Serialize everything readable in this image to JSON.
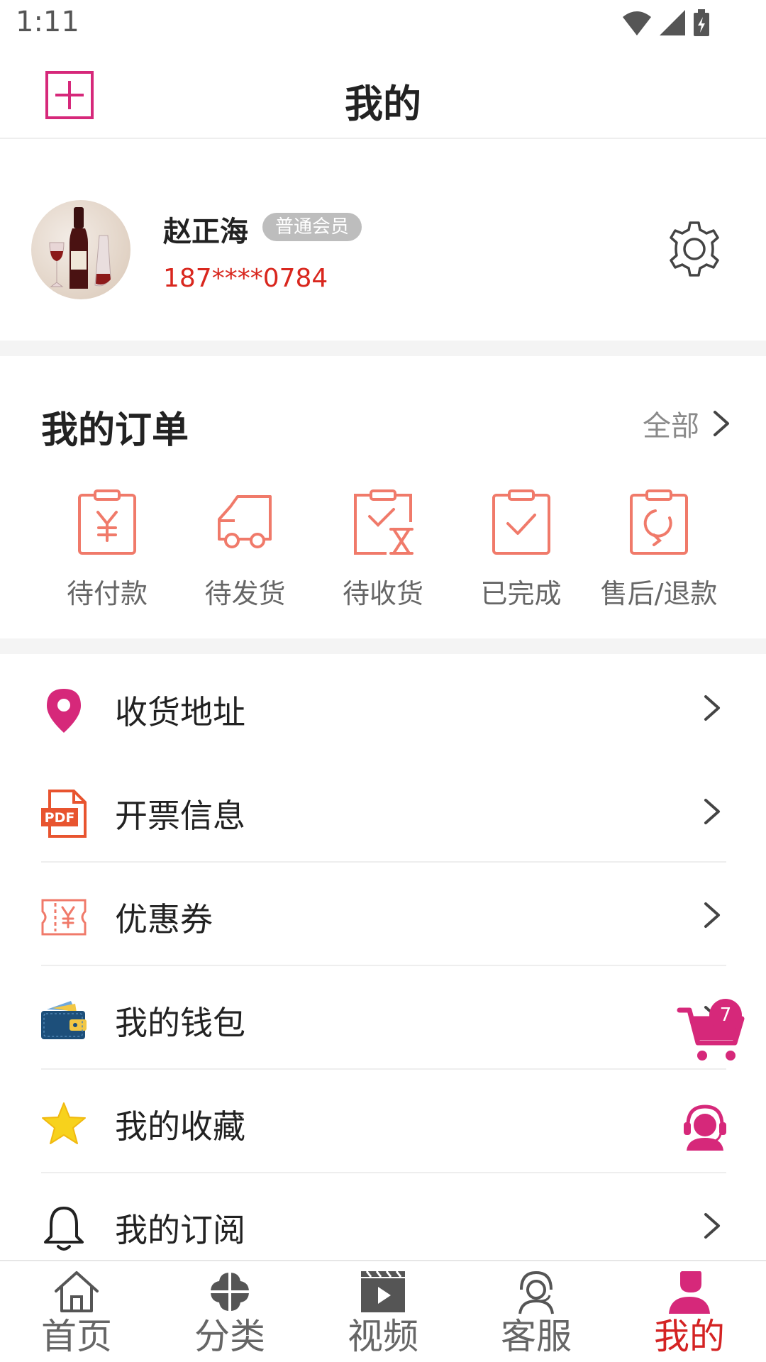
{
  "status_bar": {
    "time": "1:11"
  },
  "header": {
    "title": "我的"
  },
  "profile": {
    "name": "赵正海",
    "member_level": "普通会员",
    "phone": "187****0784"
  },
  "orders": {
    "title": "我的订单",
    "all_label": "全部",
    "items": [
      {
        "label": "待付款",
        "icon": "pending-payment-icon"
      },
      {
        "label": "待发货",
        "icon": "pending-shipment-icon"
      },
      {
        "label": "待收货",
        "icon": "pending-receipt-icon"
      },
      {
        "label": "已完成",
        "icon": "completed-icon"
      },
      {
        "label": "售后/退款",
        "icon": "refund-icon"
      }
    ]
  },
  "menu": {
    "items": [
      {
        "label": "收货地址",
        "icon": "location-pin-icon"
      },
      {
        "label": "开票信息",
        "icon": "pdf-icon"
      },
      {
        "label": "优惠券",
        "icon": "coupon-icon"
      },
      {
        "label": "我的钱包",
        "icon": "wallet-icon"
      },
      {
        "label": "我的收藏",
        "icon": "star-icon"
      },
      {
        "label": "我的订阅",
        "icon": "bell-icon"
      }
    ]
  },
  "floating": {
    "cart_count": "7"
  },
  "bottom_nav": {
    "tabs": [
      {
        "label": "首页",
        "icon": "home-icon"
      },
      {
        "label": "分类",
        "icon": "category-icon"
      },
      {
        "label": "视频",
        "icon": "video-icon"
      },
      {
        "label": "客服",
        "icon": "customer-service-icon"
      },
      {
        "label": "我的",
        "icon": "profile-icon",
        "active": true
      }
    ]
  },
  "colors": {
    "accent": "#d6287a",
    "order_icon": "#f07a6a",
    "phone": "#d9271e",
    "active_tab": "#d42323"
  }
}
